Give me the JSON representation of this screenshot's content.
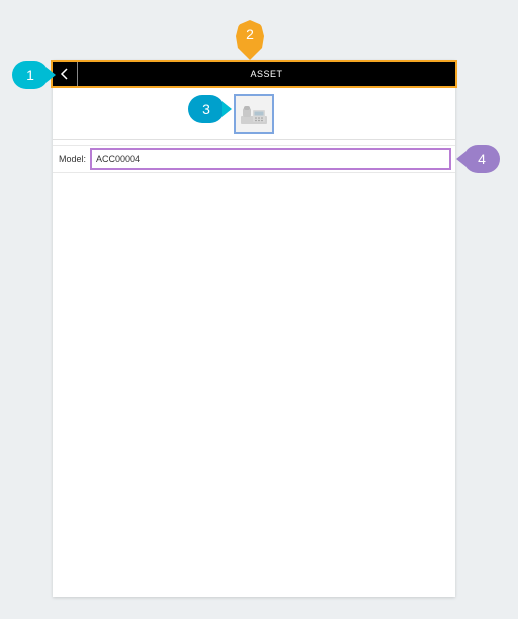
{
  "header": {
    "title": "ASSET"
  },
  "model": {
    "label": "Model:",
    "value": "ACC00004"
  },
  "callouts": {
    "c1": "1",
    "c2": "2",
    "c3": "3",
    "c4": "4"
  }
}
